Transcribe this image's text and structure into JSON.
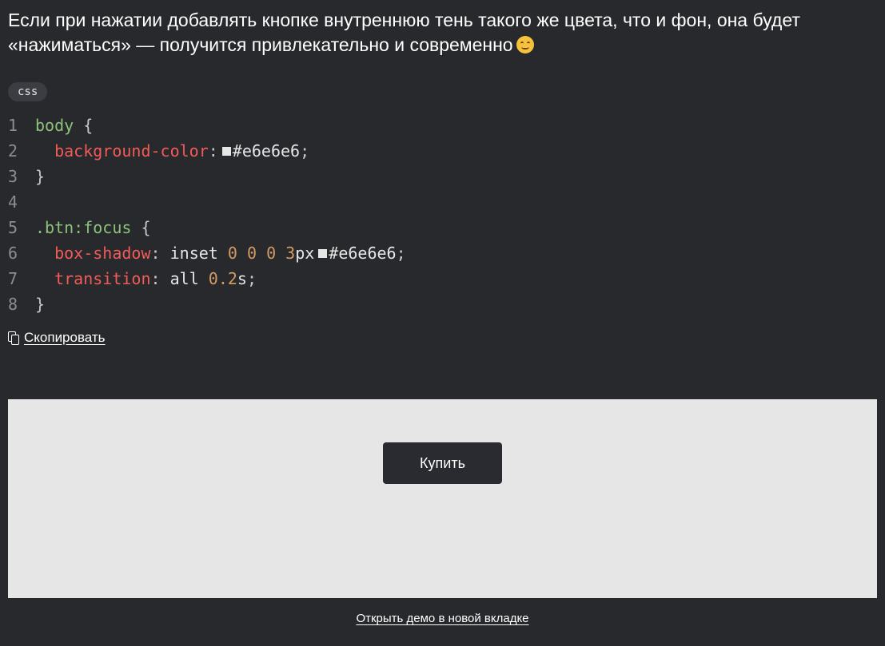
{
  "intro": {
    "text": "Если при нажатии добавлять кнопке внутреннюю тень такого же цвета, что и фон, она будет «нажиматься» — получится привлекательно и современно",
    "emoji": "winking-smiley-emoji"
  },
  "code_block": {
    "language": "css",
    "lines": [
      {
        "num": "1",
        "selector": "body",
        "open": " {"
      },
      {
        "num": "2",
        "property": "background-color",
        "value": "#e6e6e6",
        "end": ";"
      },
      {
        "num": "3",
        "close": "}"
      },
      {
        "num": "4"
      },
      {
        "num": "5",
        "selector": ".btn:focus",
        "open": " {"
      },
      {
        "num": "6",
        "property": "box-shadow",
        "kw": "inset",
        "n1": "0",
        "n2": "0",
        "n3": "0",
        "n4": "3",
        "unit4": "px",
        "value": "#e6e6e6",
        "end": ";"
      },
      {
        "num": "7",
        "property": "transition",
        "kw": "all",
        "n1": "0.2",
        "unit1": "s",
        "end": ";"
      },
      {
        "num": "8",
        "close": "}"
      }
    ],
    "swatch_color": "#e6e6e6",
    "copy_label": "Скопировать"
  },
  "demo": {
    "background": "#e6e6e6",
    "button_label": "Купить",
    "open_link": "Открыть демо в новой вкладке"
  },
  "colors": {
    "page_bg": "#28292d",
    "selector": "#8cc27a",
    "property": "#f15b58",
    "number": "#d49a62"
  }
}
